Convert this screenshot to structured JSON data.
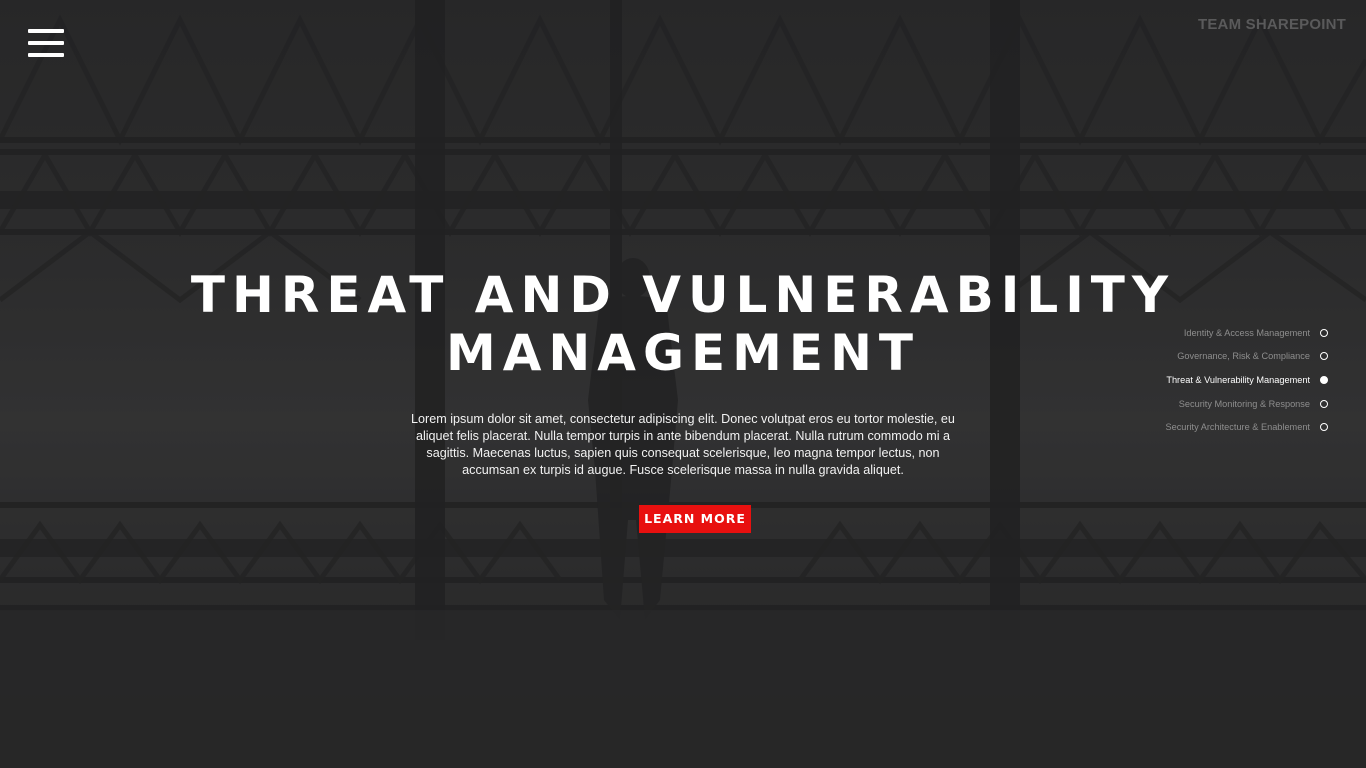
{
  "header": {
    "brand": "TEAM SHAREPOINT",
    "menu_icon": "hamburger-menu-icon"
  },
  "hero": {
    "title_line1": "THREAT AND VULNERABILITY",
    "title_line2": "MANAGEMENT",
    "description": "Lorem ipsum dolor sit amet, consectetur adipiscing elit. Donec volutpat eros eu tortor molestie, eu aliquet felis placerat. Nulla tempor turpis in ante bibendum placerat. Nulla rutrum commodo mi a sagittis. Maecenas luctus, sapien quis consequat scelerisque, leo magna tempor lectus, non accumsan ex turpis id augue. Fusce scelerisque massa in nulla gravida aliquet.",
    "cta_label": "LEARN MORE",
    "cta_color": "#e8100f"
  },
  "side_nav": {
    "items": [
      {
        "label": "Identity & Access Management",
        "active": false
      },
      {
        "label": "Governance, Risk & Compliance",
        "active": false
      },
      {
        "label": "Threat & Vulnerability Management",
        "active": true
      },
      {
        "label": "Security Monitoring & Response",
        "active": false
      },
      {
        "label": "Security Architecture & Enablement",
        "active": false
      }
    ]
  }
}
